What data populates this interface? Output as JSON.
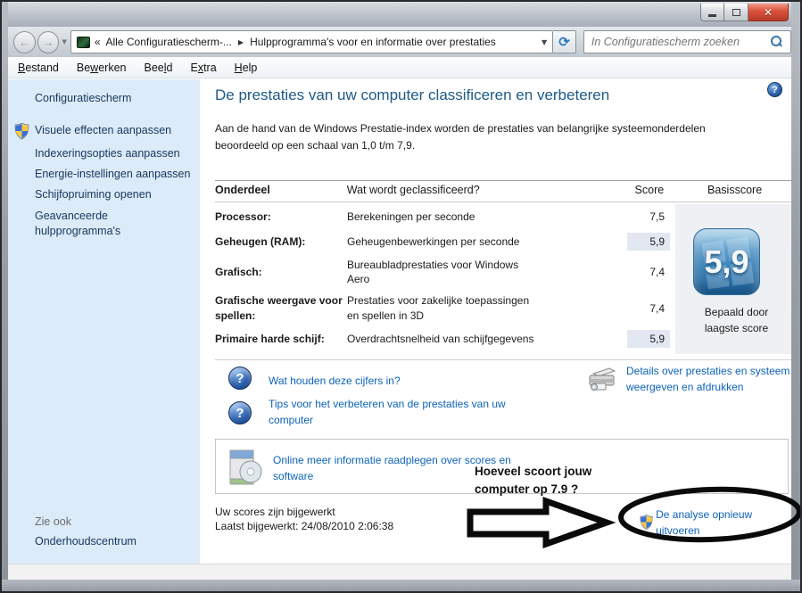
{
  "window": {
    "icons": {
      "close": "✕",
      "back": "←",
      "forward": "→",
      "history_caret": "▼",
      "refresh": "⟳",
      "help": "?"
    }
  },
  "navbar": {
    "address": {
      "overflow_chevron": "«",
      "root": "Alle Configuratiescherm-...",
      "separator": "▶",
      "current": "Hulpprogramma's voor en informatie over prestaties",
      "dropdown_caret": "▼"
    },
    "search": {
      "placeholder": "In Configuratiescherm zoeken"
    }
  },
  "menubar": {
    "items": [
      {
        "pre": "",
        "key": "B",
        "post": "estand"
      },
      {
        "pre": "Be",
        "key": "w",
        "post": "erken"
      },
      {
        "pre": "Bee",
        "key": "l",
        "post": "d"
      },
      {
        "pre": "E",
        "key": "x",
        "post": "tra"
      },
      {
        "pre": "",
        "key": "H",
        "post": "elp"
      }
    ]
  },
  "sidebar": {
    "home": "Configuratiescherm",
    "tasks": [
      {
        "label": "Visuele effecten aanpassen",
        "shield": true
      },
      {
        "label": "Indexeringsopties aanpassen",
        "shield": false
      },
      {
        "label": "Energie-instellingen aanpassen",
        "shield": false
      },
      {
        "label": "Schijfopruiming openen",
        "shield": false
      },
      {
        "label": "Geavanceerde hulpprogramma's",
        "shield": false
      }
    ],
    "see_also_header": "Zie ook",
    "see_also_link": "Onderhoudscentrum"
  },
  "main": {
    "title": "De prestaties van uw computer classificeren en verbeteren",
    "intro": "Aan de hand van de Windows Prestatie-index worden de prestaties van belangrijke systeemonderdelen beoordeeld op een schaal van 1,0 t/m 7,9.",
    "table": {
      "headers": {
        "component": "Onderdeel",
        "description": "Wat wordt geclassificeerd?",
        "score": "Score",
        "base": "Basisscore"
      },
      "rows": [
        {
          "component": "Processor:",
          "description": "Berekeningen per seconde",
          "score": "7,5"
        },
        {
          "component": "Geheugen (RAM):",
          "description": "Geheugenbewerkingen per seconde",
          "score": "5,9"
        },
        {
          "component": "Grafisch:",
          "description": "Bureaubladprestaties voor Windows Aero",
          "score": "7,4"
        },
        {
          "component": "Grafische weergave voor spellen:",
          "description": "Prestaties voor zakelijke toepassingen en spellen in 3D",
          "score": "7,4"
        },
        {
          "component": "Primaire harde schijf:",
          "description": "Overdrachtsnelheid van schijfgegevens",
          "score": "5,9"
        }
      ]
    },
    "base_score": {
      "value": "5,9",
      "caption_line1": "Bepaald door",
      "caption_line2": "laagste score"
    },
    "links": {
      "numbers": "Wat houden deze cijfers in?",
      "tips": "Tips voor het verbeteren van de prestaties van uw computer",
      "details": "Details over prestaties en systeem weergeven en afdrukken",
      "online": "Online meer informatie raadplegen over scores en software",
      "rerun": "De analyse opnieuw uitvoeren"
    },
    "status": {
      "updated": "Uw scores zijn bijgewerkt",
      "last_updated": "Laatst bijgewerkt: 24/08/2010 2:06:38"
    },
    "annotation": "Hoeveel scoort jouw computer op 7.9 ?"
  },
  "colors": {
    "link": "#0c63ba",
    "heading": "#1d5a87",
    "score_highlight": "#e2e7f1",
    "sidebar_bg": "#dcebfa",
    "close_button": "#d9503a"
  }
}
